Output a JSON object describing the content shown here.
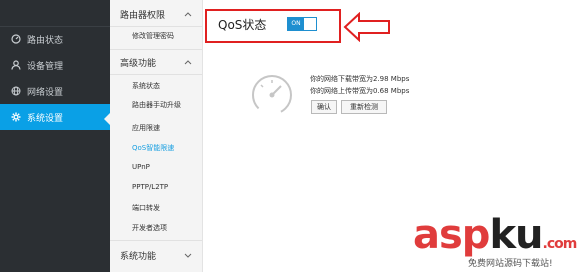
{
  "left_nav": [
    {
      "label": "路由状态",
      "icon": "speedometer-icon",
      "active": false
    },
    {
      "label": "设备管理",
      "icon": "user-icon",
      "active": false
    },
    {
      "label": "网络设置",
      "icon": "globe-icon",
      "active": false
    },
    {
      "label": "系统设置",
      "icon": "gear-icon",
      "active": true
    }
  ],
  "sub_nav": {
    "group1": "路由器权限",
    "group1_items": [
      "修改管理密码"
    ],
    "group2": "高级功能",
    "group2_items": [
      "系统状态",
      "路由器手动升级",
      "应用限速",
      "QoS智能限速",
      "UPnP",
      "PPTP/L2TP",
      "端口转发",
      "开发者选项"
    ],
    "group3": "系统功能"
  },
  "qos": {
    "title": "QoS状态",
    "toggle_label": "ON",
    "download": "你的网络下载带宽为2.98 Mbps",
    "upload": "你的网络上传带宽为0.68 Mbps",
    "confirm_btn": "确认",
    "retest_btn": "重新检测"
  },
  "watermark": {
    "brand_a": "asp",
    "brand_b": "ku",
    "tld": ".com",
    "sub": "免费网站源码下载站!"
  },
  "colors": {
    "accent": "#0aa0e6",
    "highlight_box": "#e02020",
    "sidebar_bg": "#2b2f33"
  }
}
